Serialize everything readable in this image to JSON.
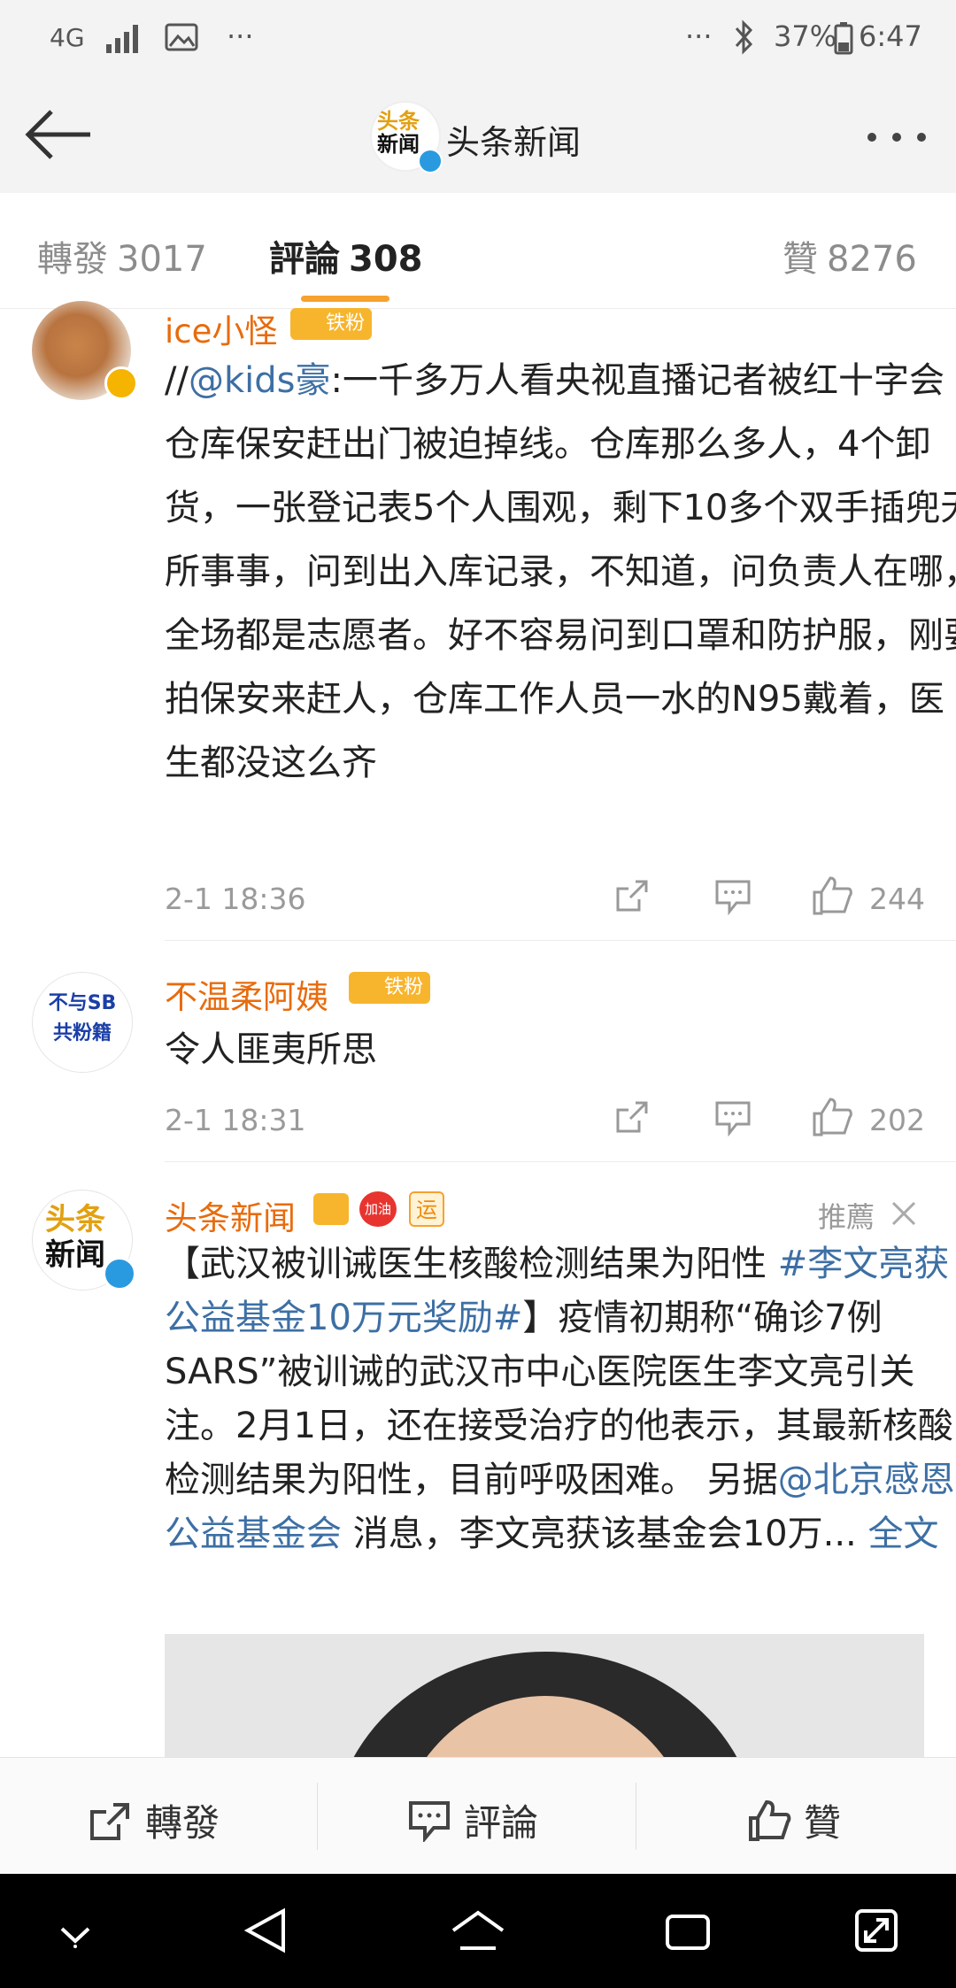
{
  "status_bar": {
    "network": "4G",
    "dots_left": "···",
    "dots_right": "···",
    "battery": "37%",
    "time": "6:47"
  },
  "header": {
    "channel_logo_line1": "头条",
    "channel_logo_line2": "新闻",
    "title": "头条新闻"
  },
  "tabs": [
    {
      "label": "轉發",
      "count": "3017"
    },
    {
      "label": "評論",
      "count": "308"
    },
    {
      "label": "贊",
      "count": "8276"
    }
  ],
  "comments": [
    {
      "username": "ice小怪",
      "badge": "铁粉",
      "content_prefix": "//",
      "mention": "@kids豪",
      "content": ":一千多万人看央视直播记者被红十字会仓库保安赶出门被迫掉线。仓库那么多人，4个卸货，一张登记表5个人围观，剩下10多个双手插兜无所事事，问到出入库记录，不知道，问负责人在哪，全场都是志愿者。好不容易问到口罩和防护服，刚要拍保安来赶人，仓库工作人员一水的N95戴着，医生都没这么齐",
      "time": "2-1 18:36",
      "likes": "244"
    },
    {
      "username": "不温柔阿姨",
      "badge": "铁粉",
      "avatar_line1": "不与SB",
      "avatar_line2": "共粉籍",
      "content": "令人匪夷所思",
      "time": "2-1 18:31",
      "likes": "202"
    },
    {
      "username": "头条新闻",
      "badge_jiayou": "加油",
      "badge_yun": "运",
      "recommend": "推薦",
      "text1": "【武汉被训诫医生核酸检测结果为阳性 ",
      "hashtag": "#李文亮获公益基金10万元奖励#",
      "text2": "】疫情初期称“确诊7例SARS”被训诫的武汉市中心医院医生李文亮引关注。2月1日，还在接受治疗的他表示，其最新核酸检测结果为阳性，目前呼吸困难。 另据",
      "mention": "@北京感恩公益基金会",
      "text3": " 消息，李文亮获该基金会10万... ",
      "full_text": "全文"
    }
  ],
  "action_bar": {
    "repost": "轉發",
    "comment": "評論",
    "like": "贊"
  },
  "colors": {
    "accent": "#f7a12f",
    "username": "#e86b0c",
    "link": "#3d6fa4"
  }
}
